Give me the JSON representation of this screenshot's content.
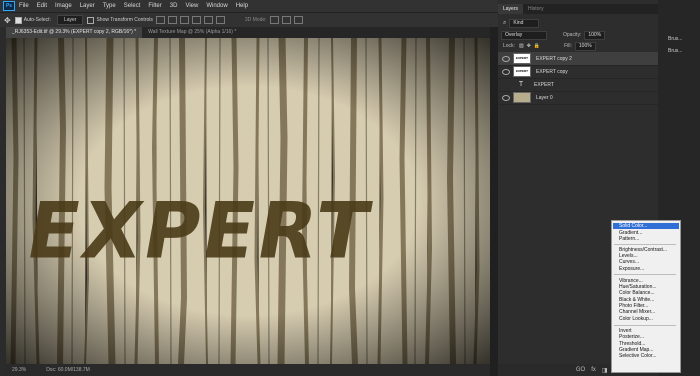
{
  "menubar": {
    "logo": "Ps",
    "items": [
      "File",
      "Edit",
      "Image",
      "Layer",
      "Type",
      "Select",
      "Filter",
      "3D",
      "View",
      "Window",
      "Help"
    ],
    "window_controls": [
      "—",
      "☐",
      "✕"
    ]
  },
  "options": {
    "auto_select": "Auto-Select:",
    "target": "Layer",
    "transform": "Show Transform Controls",
    "mode3d": "3D Mode:"
  },
  "doc": {
    "tabs": [
      "_RJ6353-Edit.tif @ 29.3% (EXPERT copy 2, RGB/16*) *",
      "Wall Texture Map @ 25% (Alpha 1/16) *"
    ],
    "text": "EXPERT"
  },
  "status": {
    "zoom": "29.3%",
    "doc": "Doc: 60.0M/138.7M"
  },
  "layers_panel": {
    "tabs": [
      "Layers",
      "History"
    ],
    "kind": "Kind",
    "blend_mode": "Overlay",
    "opacity_label": "Opacity:",
    "opacity": "100%",
    "lock_label": "Lock:",
    "fill_label": "Fill:",
    "fill": "100%",
    "layers": [
      {
        "name": "EXPERT copy 2",
        "thumb": "EXPERT"
      },
      {
        "name": "EXPERT copy",
        "thumb": "EXPERT"
      },
      {
        "name": "EXPERT",
        "thumb": "T"
      },
      {
        "name": "Layer 0",
        "thumb": ""
      }
    ],
    "footer": [
      "GO",
      "fx",
      "◨",
      "◐",
      "▭",
      "+",
      "🗑"
    ]
  },
  "right_panel": {
    "items": [
      "Brus...",
      "Brus..."
    ]
  },
  "adjustment_menu": [
    "Solid Color...",
    "Gradient...",
    "Pattern...",
    "Brightness/Contrast...",
    "Levels...",
    "Curves...",
    "Exposure...",
    "Vibrance...",
    "Hue/Saturation...",
    "Color Balance...",
    "Black & White...",
    "Photo Filter...",
    "Channel Mixer...",
    "Color Lookup...",
    "Invert",
    "Posterize...",
    "Threshold...",
    "Gradient Map...",
    "Selective Color..."
  ]
}
